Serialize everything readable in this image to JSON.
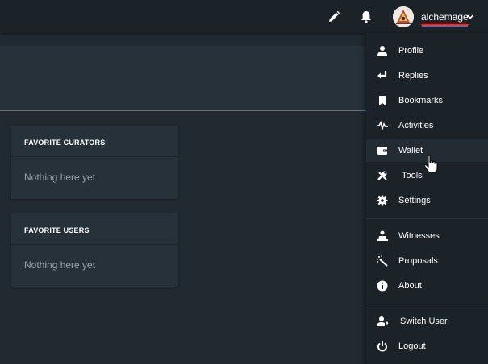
{
  "header": {
    "username": "alchemage",
    "icons": [
      "pencil-icon",
      "bell-icon",
      "chevron-down-icon"
    ]
  },
  "cards": [
    {
      "title": "FAVORITE CURATORS",
      "empty_text": "Nothing here yet"
    },
    {
      "title": "FAVORITE USERS",
      "empty_text": "Nothing here yet"
    }
  ],
  "menu": {
    "items": [
      {
        "label": "Profile",
        "icon": "user-icon"
      },
      {
        "label": "Replies",
        "icon": "reply-icon"
      },
      {
        "label": "Bookmarks",
        "icon": "bookmark-icon"
      },
      {
        "label": "Activities",
        "icon": "activity-icon"
      },
      {
        "label": "Wallet",
        "icon": "wallet-icon"
      },
      {
        "label": "Tools",
        "icon": "tools-icon"
      },
      {
        "label": "Settings",
        "icon": "gear-icon"
      },
      {
        "label": "Witnesses",
        "icon": "witness-icon"
      },
      {
        "label": "Proposals",
        "icon": "magic-wand-icon"
      },
      {
        "label": "About",
        "icon": "info-icon"
      },
      {
        "label": "Switch User",
        "icon": "switch-user-icon"
      },
      {
        "label": "Logout",
        "icon": "power-icon"
      }
    ],
    "hovered": "Wallet"
  },
  "colors": {
    "background": "#212a31",
    "topbar": "#1b2228",
    "card": "#27313a",
    "accent_line": "#3b7fc4",
    "muted_text": "#9aa3aa"
  }
}
